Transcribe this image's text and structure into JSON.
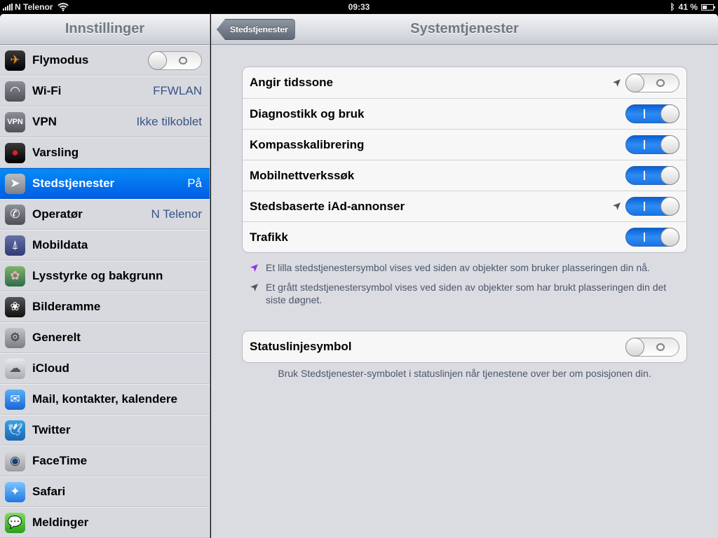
{
  "status_bar": {
    "carrier": "N Telenor",
    "time": "09:33",
    "battery": "41 %",
    "battery_level_percent": 41
  },
  "sidebar": {
    "title": "Innstillinger",
    "items": [
      {
        "label": "Flymodus",
        "value": "",
        "toggle": "off",
        "icon": "airplane-icon"
      },
      {
        "label": "Wi-Fi",
        "value": "FFWLAN",
        "icon": "wifi-icon"
      },
      {
        "label": "VPN",
        "value": "Ikke tilkoblet",
        "icon": "vpn-icon",
        "icon_text": "VPN"
      },
      {
        "label": "Varsling",
        "value": "",
        "icon": "notifications-icon"
      },
      {
        "label": "Stedstjenester",
        "value": "På",
        "icon": "location-icon",
        "selected": true
      },
      {
        "label": "Operatør",
        "value": "N Telenor",
        "icon": "phone-icon"
      },
      {
        "label": "Mobildata",
        "value": "",
        "icon": "cellular-icon"
      },
      {
        "label": "Lysstyrke og bakgrunn",
        "value": "",
        "icon": "wallpaper-icon"
      },
      {
        "label": "Bilderamme",
        "value": "",
        "icon": "picture-frame-icon"
      },
      {
        "label": "Generelt",
        "value": "",
        "icon": "gear-icon"
      },
      {
        "label": "iCloud",
        "value": "",
        "icon": "cloud-icon"
      },
      {
        "label": "Mail, kontakter, kalendere",
        "value": "",
        "icon": "mail-icon"
      },
      {
        "label": "Twitter",
        "value": "",
        "icon": "twitter-icon"
      },
      {
        "label": "FaceTime",
        "value": "",
        "icon": "facetime-icon"
      },
      {
        "label": "Safari",
        "value": "",
        "icon": "safari-icon"
      },
      {
        "label": "Meldinger",
        "value": "",
        "icon": "messages-icon"
      }
    ]
  },
  "detail": {
    "back_label": "Stedstjenester",
    "title": "Systemtjenester",
    "services": [
      {
        "label": "Angir tidssone",
        "on": false,
        "location_arrow": "gray"
      },
      {
        "label": "Diagnostikk og bruk",
        "on": true,
        "location_arrow": ""
      },
      {
        "label": "Kompasskalibrering",
        "on": true,
        "location_arrow": ""
      },
      {
        "label": "Mobilnettverkssøk",
        "on": true,
        "location_arrow": ""
      },
      {
        "label": "Stedsbaserte iAd-annonser",
        "on": true,
        "location_arrow": "gray"
      },
      {
        "label": "Trafikk",
        "on": true,
        "location_arrow": ""
      }
    ],
    "legend": [
      {
        "color": "#9b30e8",
        "text": "Et lilla stedstjenestersymbol vises ved siden av objekter som bruker plasseringen din nå."
      },
      {
        "color": "#555555",
        "text": "Et grått stedstjenestersymbol vises ved siden av objekter som har brukt plasseringen din det siste døgnet."
      }
    ],
    "status_icon": {
      "label": "Statuslinjesymbol",
      "on": false
    },
    "status_note": "Bruk Stedstjenester-symbolet i statuslinjen når tjenestene over ber om posisjonen din."
  }
}
